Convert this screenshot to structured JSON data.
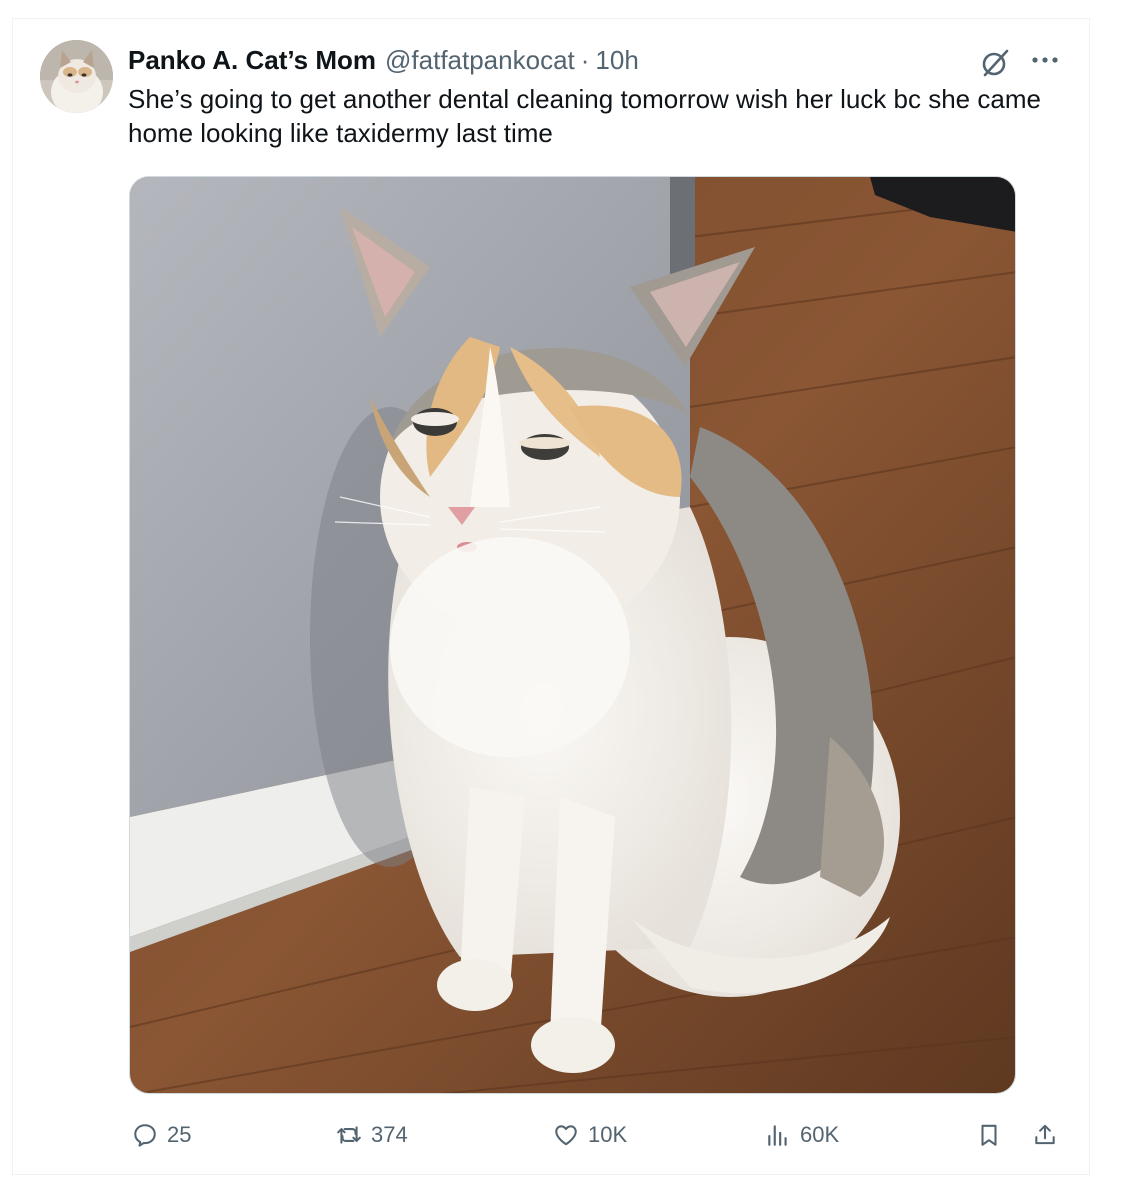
{
  "tweet": {
    "display_name": "Panko A. Cat’s Mom",
    "handle": "@fatfatpankocat",
    "separator": "·",
    "time": "10h",
    "text": "She’s going to get another dental cleaning tomorrow wish her luck bc she came home looking like taxidermy last time"
  },
  "actions": {
    "replies": "25",
    "reposts": "374",
    "likes": "10K",
    "views": "60K"
  },
  "icons": {
    "avatar": "avatar-cat-photo",
    "grok": "grok-icon",
    "more": "more-icon",
    "reply": "reply-icon",
    "repost": "repost-icon",
    "like": "like-icon",
    "views": "views-icon",
    "bookmark": "bookmark-icon",
    "share": "share-icon"
  },
  "colors": {
    "text_primary": "#0f1419",
    "text_secondary": "#536471",
    "border": "#cfd9de"
  }
}
